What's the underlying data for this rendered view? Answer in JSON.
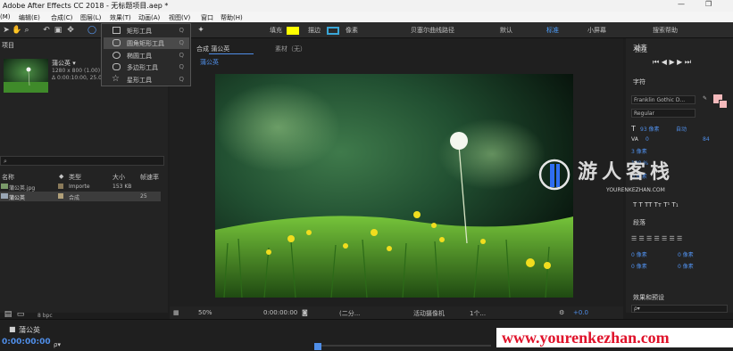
{
  "window": {
    "title": "Adobe After Effects CC 2018 - 无标题项目.aep *",
    "min_label": "—",
    "max_label": "❐"
  },
  "menu": [
    "(M)",
    "编辑(E)",
    "合成(C)",
    "图层(L)",
    "效果(T)",
    "动画(A)",
    "视图(V)",
    "窗口",
    "帮助(H)"
  ],
  "toolbar": {
    "fill_label": "填充",
    "stroke_label": "描边",
    "pixel_label": "像素",
    "bezier_label": "贝塞尔曲线路径",
    "default_label": "默认",
    "standard_label": "标准",
    "small_label": "小屏幕",
    "search_label": "搜索帮助",
    "fill_color": "#ffff00",
    "stroke_color": "#3aa7d8"
  },
  "shape_menu": {
    "items": [
      {
        "label": "矩形工具",
        "shortcut": "Q"
      },
      {
        "label": "圆角矩形工具",
        "shortcut": "Q"
      },
      {
        "label": "椭圆工具",
        "shortcut": "Q"
      },
      {
        "label": "多边形工具",
        "shortcut": "Q"
      },
      {
        "label": "星形工具",
        "shortcut": "Q"
      }
    ],
    "selected_index": 1
  },
  "project": {
    "title": "项目",
    "comp_name": "蒲公英 ▾",
    "info1": "1280 x 800 (1.00)",
    "info2": "Δ 0:00:10:00, 25.00",
    "columns": [
      "名称",
      "类型",
      "大小",
      "帧速率"
    ],
    "rows": [
      {
        "name": "蒲公英.jpg",
        "type": "Importe",
        "size": "153 KB",
        "rate": ""
      },
      {
        "name": "蒲公英",
        "type": "合成",
        "size": "",
        "rate": "25"
      }
    ],
    "bpc": "8 bpc"
  },
  "comp": {
    "tab_label": "合成 蒲公英",
    "footage_label": "素材（无）",
    "crumb": "蒲公英",
    "zoom": "50%",
    "timecode": "0:00:00:00",
    "res": "(二分...",
    "camera": "活动摄像机",
    "views": "1个...",
    "offset": "+0.0"
  },
  "right": {
    "tab_label": "标准",
    "align": "对齐",
    "preview": "预览",
    "character": "字符",
    "font": "Franklin Gothic D...",
    "style": "Regular",
    "size": "93 像素",
    "leading": "自动",
    "tracking": "0",
    "stroke_w": "3 像素",
    "scale": "100 %",
    "baseline": "0 像素",
    "paragraph": "段落",
    "indent_val": "0 像素",
    "effects": "效果和预设",
    "tracking_val": "84",
    "search_placeholder": "ρ▾"
  },
  "timeline": {
    "comp_tab": "蒲公英",
    "timecode": "0:00:00:00"
  },
  "overlay": {
    "logo_text": "游人客栈",
    "logo_sub": "YOURENKEZHAN.COM",
    "watermark": "www.yourenkezhan.com"
  }
}
